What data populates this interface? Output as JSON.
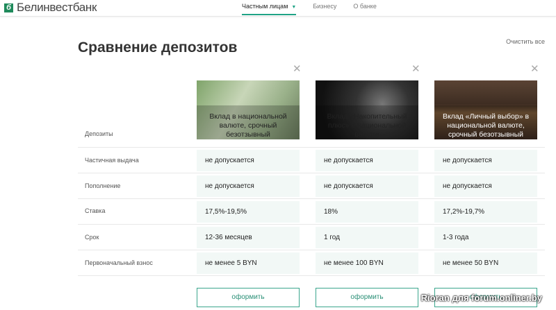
{
  "header": {
    "logo": "Белинвестбанк",
    "logo_mark": "б",
    "nav": [
      "Частным лицам",
      "Бизнесу",
      "О банке"
    ]
  },
  "title": "Сравнение депозитов",
  "clear_all": "Очистить все",
  "row_labels": [
    "Депозиты",
    "Частичная выдача",
    "Пополнение",
    "Ставка",
    "Срок",
    "Первоначальный взнос"
  ],
  "deposits": [
    {
      "name": "Вклад в национальной валюте, срочный безотзывный",
      "partial": "не допускается",
      "topup": "не допускается",
      "rate": "17,5%-19,5%",
      "term": "12-36 месяцев",
      "initial": "не менее 5 BYN",
      "button": "оформить"
    },
    {
      "name": "Вклад «Накопительный плюс» в национальной валюте",
      "partial": "не допускается",
      "topup": "не допускается",
      "rate": "18%",
      "term": "1 год",
      "initial": "не менее 100 BYN",
      "button": "оформить"
    },
    {
      "name": "Вклад «Личный выбор» в национальной валюте, срочный безотзывный",
      "partial": "не допускается",
      "topup": "не допускается",
      "rate": "17,2%-19,7%",
      "term": "1-3 года",
      "initial": "не менее 50 BYN",
      "button": "оформить"
    }
  ],
  "watermark": "Rioran для forum.onliner.by"
}
